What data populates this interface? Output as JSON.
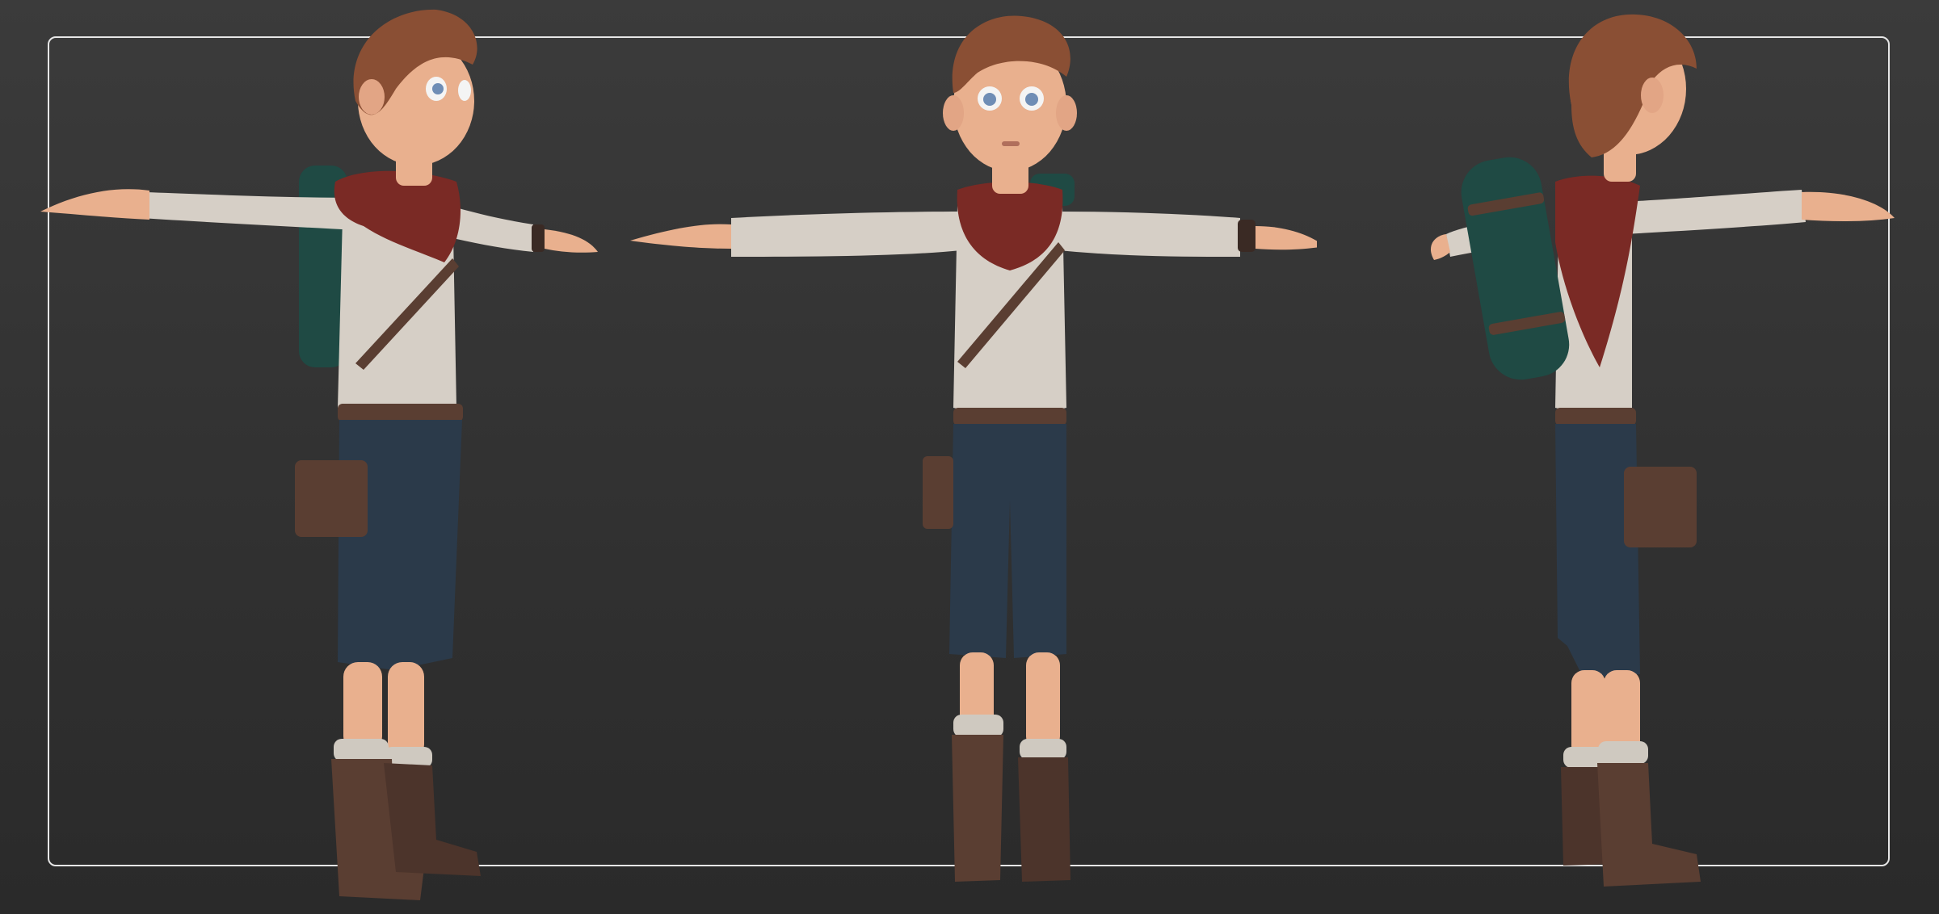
{
  "scene": {
    "colors": {
      "background_top": "#3b3b3b",
      "background_bottom": "#2a2a2a",
      "frame": "#e6e6e6",
      "skin": "#e9b08e",
      "hair": "#8a4f34",
      "shirt": "#d6cfc6",
      "scarf": "#7a2a25",
      "shorts": "#2b3a4a",
      "leather": "#5a3e32",
      "sock": "#cfc9c0",
      "bedroll": "#1f4a44"
    },
    "views": [
      {
        "view": "three-quarter-left"
      },
      {
        "view": "front"
      },
      {
        "view": "three-quarter-back-right"
      }
    ]
  }
}
